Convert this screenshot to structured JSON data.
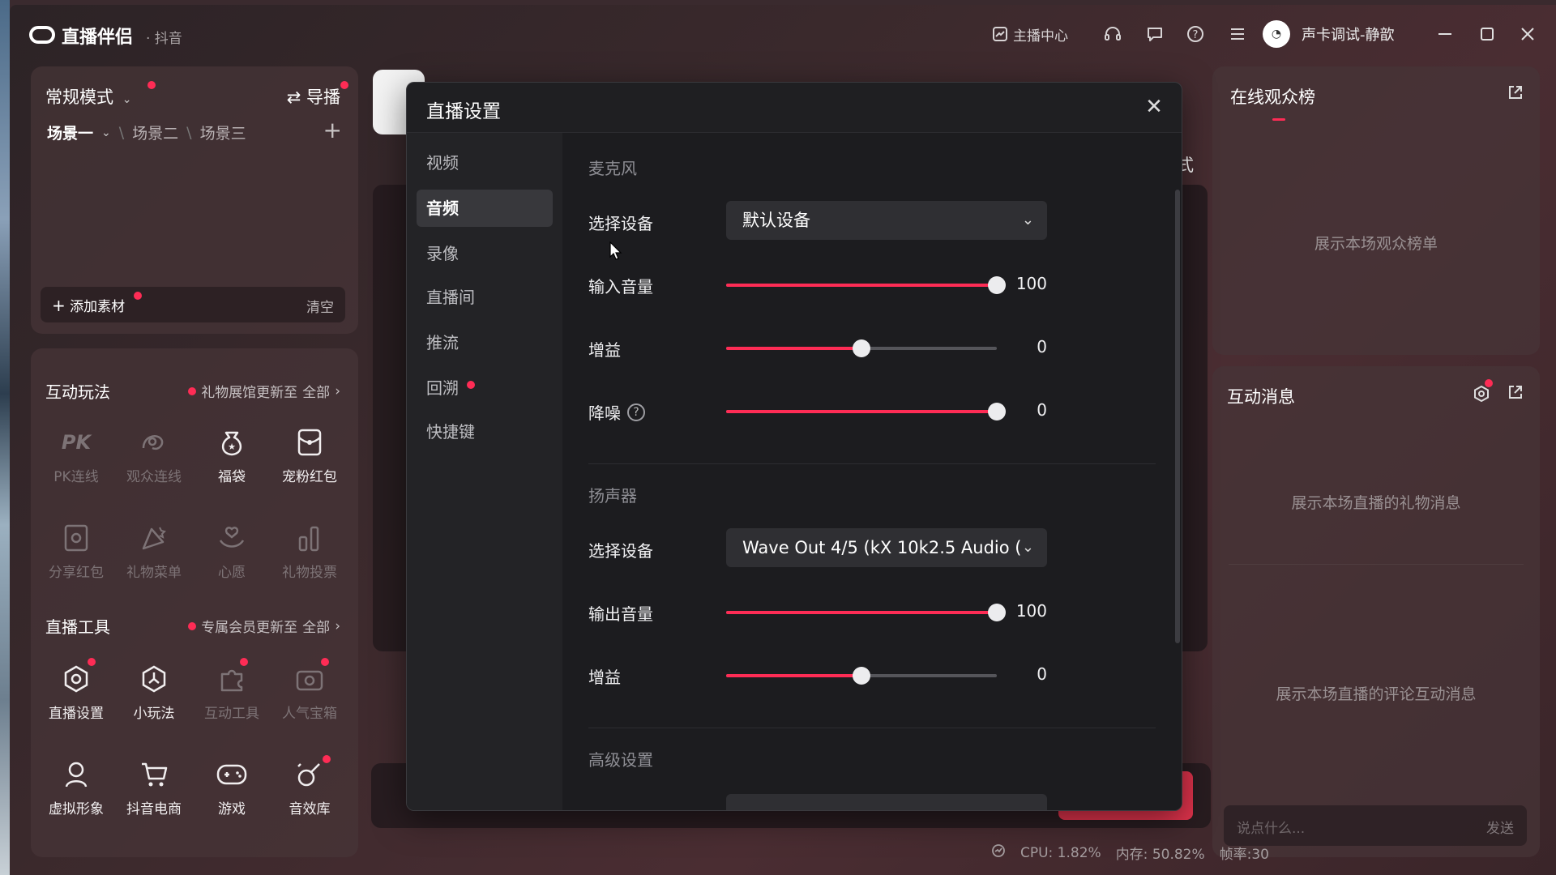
{
  "titlebar": {
    "app_name": "直播伴侣",
    "platform": "· 抖音",
    "anchor_center": "主播中心",
    "user_name": "声卡调试-静歆"
  },
  "left_top": {
    "mode": "常规模式",
    "guide": "导播",
    "scenes": [
      "场景一",
      "场景二",
      "场景三"
    ],
    "add_material": "添加素材",
    "clear": "清空"
  },
  "interactive": {
    "title": "互动玩法",
    "update": "礼物展馆更新至",
    "all": "全部",
    "items": [
      {
        "label": "PK连线",
        "icon": "pk-icon",
        "enabled": false
      },
      {
        "label": "观众连线",
        "icon": "audience-link-icon",
        "enabled": false
      },
      {
        "label": "福袋",
        "icon": "lucky-bag-icon",
        "enabled": true
      },
      {
        "label": "宠粉红包",
        "icon": "red-packet-icon",
        "enabled": true
      },
      {
        "label": "分享红包",
        "icon": "share-packet-icon",
        "enabled": false
      },
      {
        "label": "礼物菜单",
        "icon": "gift-menu-icon",
        "enabled": false
      },
      {
        "label": "心愿",
        "icon": "wish-icon",
        "enabled": false
      },
      {
        "label": "礼物投票",
        "icon": "gift-vote-icon",
        "enabled": false
      }
    ]
  },
  "tools": {
    "title": "直播工具",
    "update": "专属会员更新至",
    "all": "全部",
    "items": [
      {
        "label": "直播设置",
        "icon": "live-settings-icon",
        "enabled": true
      },
      {
        "label": "小玩法",
        "icon": "mini-game-icon",
        "enabled": true
      },
      {
        "label": "互动工具",
        "icon": "interact-tool-icon",
        "enabled": false
      },
      {
        "label": "人气宝箱",
        "icon": "popularity-box-icon",
        "enabled": false
      },
      {
        "label": "虚拟形象",
        "icon": "avatar-figure-icon",
        "enabled": true
      },
      {
        "label": "抖音电商",
        "icon": "shop-cart-icon",
        "enabled": true
      },
      {
        "label": "游戏",
        "icon": "gamepad-icon",
        "enabled": true
      },
      {
        "label": "音效库",
        "icon": "sound-lib-icon",
        "enabled": true
      }
    ]
  },
  "center": {
    "peek_text": "式"
  },
  "right": {
    "viewers_title": "在线观众榜",
    "viewers_placeholder": "展示本场观众榜单",
    "messages_title": "互动消息",
    "gift_placeholder": "展示本场直播的礼物消息",
    "comment_placeholder": "展示本场直播的评论互动消息",
    "input_placeholder": "说点什么...",
    "send": "发送"
  },
  "status": {
    "cpu": "CPU: 1.82%",
    "mem": "内存: 50.82%",
    "fps": "帧率:30"
  },
  "dialog": {
    "title": "直播设置",
    "nav": [
      "视频",
      "音频",
      "录像",
      "直播间",
      "推流",
      "回溯",
      "快捷键"
    ],
    "active_nav": "音频",
    "mic": {
      "group": "麦克风",
      "device_label": "选择设备",
      "device_value": "默认设备",
      "input_volume_label": "输入音量",
      "input_volume": 100,
      "gain_label": "增益",
      "gain": 0,
      "gain_fill": 0.5,
      "noise_label": "降噪",
      "noise": 0,
      "noise_fill": 1.0
    },
    "speaker": {
      "group": "扬声器",
      "device_label": "选择设备",
      "device_value": "Wave Out 4/5 (kX 10k2.5 Audio (",
      "output_volume_label": "输出音量",
      "output_volume": 100,
      "gain_label": "增益",
      "gain": 0,
      "gain_fill": 0.5
    },
    "advanced": {
      "group": "高级设置"
    }
  },
  "colors": {
    "accent": "#fe2c55",
    "dialog_bg": "#1f1f22"
  }
}
